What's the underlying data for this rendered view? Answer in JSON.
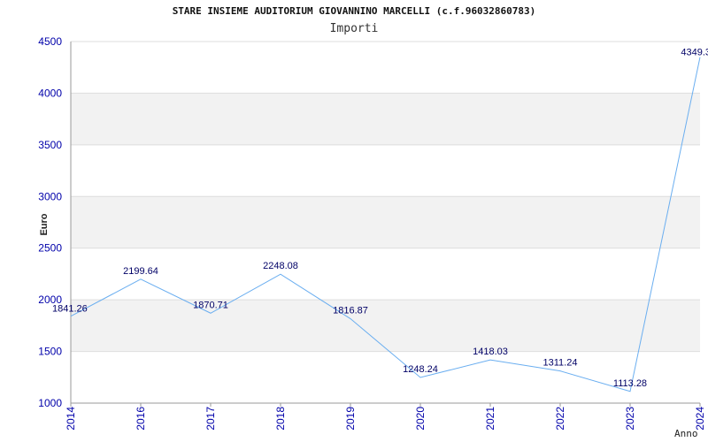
{
  "title": "STARE INSIEME AUDITORIUM GIOVANNINO MARCELLI (c.f.96032860783)",
  "subtitle": "Importi",
  "colors": {
    "line": "#6aaef0",
    "band": "#f2f2f2",
    "grid": "#dddddd",
    "axis_text": "#0000aa",
    "point_label": "#000066"
  },
  "chart_data": {
    "type": "line",
    "title": "STARE INSIEME AUDITORIUM GIOVANNINO MARCELLI (c.f.96032860783)",
    "subtitle": "Importi",
    "xlabel": "Anno",
    "ylabel": "Euro",
    "x": [
      "2014",
      "2016",
      "2017",
      "2018",
      "2019",
      "2020",
      "2021",
      "2022",
      "2023",
      "2024"
    ],
    "values": [
      1841.26,
      2199.64,
      1870.71,
      2248.08,
      1816.87,
      1248.24,
      1418.03,
      1311.24,
      1113.28,
      4349.3
    ],
    "labels": [
      "1841.26",
      "2199.64",
      "1870.71",
      "2248.08",
      "1816.87",
      "1248.24",
      "1418.03",
      "1311.24",
      "1113.28",
      "4349.3"
    ],
    "yticks": [
      1000,
      1500,
      2000,
      2500,
      3000,
      3500,
      4000,
      4500
    ],
    "ylim": [
      1000,
      4500
    ],
    "grid": true
  }
}
